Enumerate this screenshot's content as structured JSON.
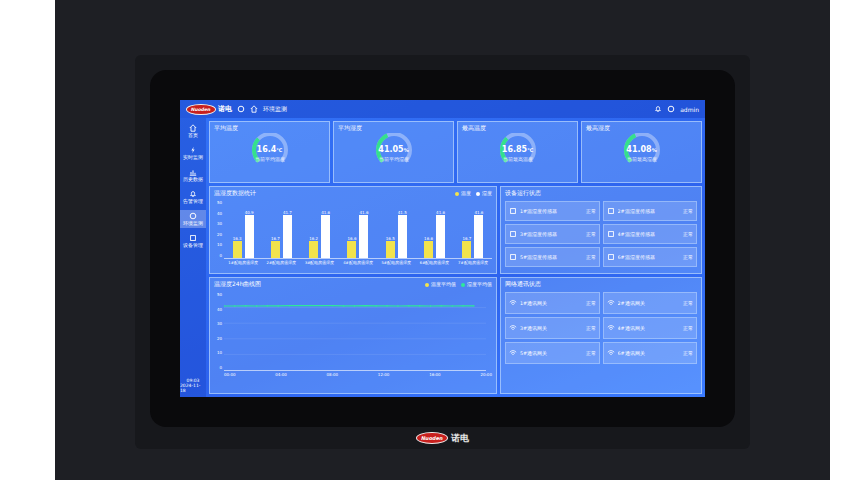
{
  "brand": {
    "logo": "Nuoden",
    "name": "诺电"
  },
  "topbar": {
    "title": "环境监测",
    "user": "admin"
  },
  "sidebar": {
    "items": [
      {
        "label": "首页",
        "selected": false
      },
      {
        "label": "实时监测",
        "selected": false
      },
      {
        "label": "历史数据",
        "selected": false
      },
      {
        "label": "告警管理",
        "selected": false
      },
      {
        "label": "环境监测",
        "selected": true
      },
      {
        "label": "设备管理",
        "selected": false
      }
    ],
    "time": "09:03",
    "date": "2024-11-18"
  },
  "gauges": [
    {
      "title": "平均温度",
      "value": "16.4",
      "unit": "℃",
      "caption": "当前平均温度",
      "level": 0.33
    },
    {
      "title": "平均湿度",
      "value": "41.05",
      "unit": "%",
      "caption": "当前平均湿度",
      "level": 0.41
    },
    {
      "title": "最高温度",
      "value": "16.85",
      "unit": "℃",
      "caption": "当前最高温度",
      "level": 0.34
    },
    {
      "title": "最高湿度",
      "value": "41.08",
      "unit": "%",
      "caption": "当前最高湿度",
      "level": 0.41
    }
  ],
  "bar_chart": {
    "title": "温湿度数据统计",
    "legend": [
      {
        "label": "温度",
        "color": "#f2e34c"
      },
      {
        "label": "湿度",
        "color": "#ffffff"
      }
    ],
    "y_ticks": [
      "50",
      "40",
      "30",
      "20",
      "10",
      "0"
    ],
    "categories": [
      "1#配电房温湿度",
      "2#配电房温湿度",
      "3#配电房温湿度",
      "4#配电房温湿度",
      "5#配电房温湿度",
      "6#配电房温湿度",
      "7#配电房温湿度"
    ],
    "series": [
      {
        "name": "温度",
        "color": "#f2e34c",
        "values": [
          16.3,
          16.7,
          16.2,
          16.6,
          16.5,
          16.6,
          16.7
        ],
        "labels": [
          "16.3",
          "16.7",
          "16.2",
          "16.6",
          "16.5",
          "16.6",
          "16.7"
        ]
      },
      {
        "name": "湿度",
        "color": "#ffffff",
        "values": [
          40.9,
          41.7,
          41.6,
          41.6,
          41.5,
          41.6,
          41.6
        ],
        "labels": [
          "40.9",
          "41.7",
          "41.6",
          "41.6",
          "41.5",
          "41.6",
          "41.6"
        ]
      }
    ]
  },
  "line_chart": {
    "title": "温湿度24h曲线图",
    "legend": [
      {
        "label": "温度平均值",
        "color": "#f2e34c"
      },
      {
        "label": "湿度平均值",
        "color": "#2ee89a"
      }
    ],
    "y_ticks": [
      "50",
      "40",
      "30",
      "20",
      "10",
      "0"
    ],
    "x_ticks": [
      "00:00",
      "04:00",
      "08:00",
      "12:00",
      "16:00",
      "20:00"
    ],
    "series": [
      {
        "name": "湿度平均值",
        "color": "#2ee89a",
        "values": [
          41.0,
          41.0,
          41.1,
          41.0,
          41.1,
          41.1,
          41.2,
          41.3,
          41.3,
          41.2,
          41.2,
          41.1,
          41.1,
          41.2,
          41.1,
          41.1,
          41.0,
          41.1,
          41.1,
          41.0,
          41.1,
          41.0,
          41.1,
          41.1
        ]
      }
    ]
  },
  "status_panels": [
    {
      "title": "设备运行状态",
      "items": [
        {
          "name": "1#温湿度传感器",
          "status": "正常"
        },
        {
          "name": "2#温湿度传感器",
          "status": "正常"
        },
        {
          "name": "3#温湿度传感器",
          "status": "正常"
        },
        {
          "name": "4#温湿度传感器",
          "status": "正常"
        },
        {
          "name": "5#温湿度传感器",
          "status": "正常"
        },
        {
          "name": "6#温湿度传感器",
          "status": "正常"
        }
      ]
    },
    {
      "title": "网络通讯状态",
      "items": [
        {
          "name": "1#通讯网关",
          "status": "正常"
        },
        {
          "name": "2#通讯网关",
          "status": "正常"
        },
        {
          "name": "3#通讯网关",
          "status": "正常"
        },
        {
          "name": "4#通讯网关",
          "status": "正常"
        },
        {
          "name": "5#通讯网关",
          "status": "正常"
        },
        {
          "name": "6#通讯网关",
          "status": "正常"
        }
      ]
    }
  ],
  "bezel_logo": {
    "logo": "Nuoden",
    "name": "诺电"
  }
}
